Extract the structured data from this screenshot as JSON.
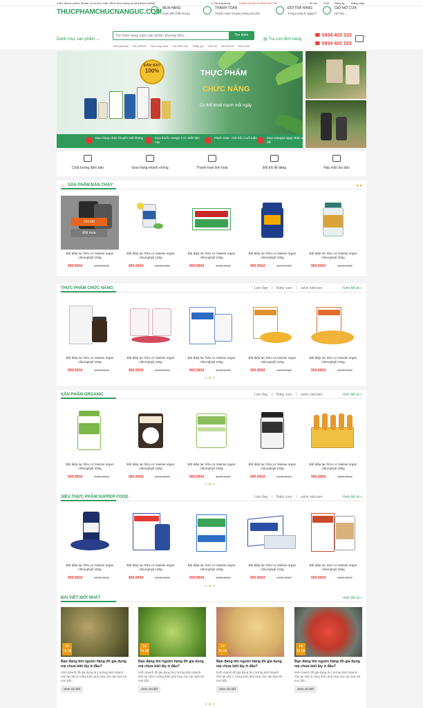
{
  "topbar": {
    "promo_prefix": "Bio Island Lysine Starter",
    "promo_text": "Lý ra bình luận \"Mình pha chung và sữa được không \"",
    "dist": "Tải ứng dụng",
    "hotline_label": "Khiếu nại bảo lỗi",
    "hotline": "0934 403 333",
    "links": [
      "Tin tức",
      "FQA",
      "Đăng ký",
      "Đăng nhập"
    ]
  },
  "header": {
    "logo": "THUCPHAMCHUCNANGUC.COM",
    "features": [
      {
        "title": "MUA HÀNG",
        "sub": "Cam kết chất lượng"
      },
      {
        "title": "THANH TOÁN",
        "sub": "Thanh toán và giao hàng tại nhà"
      },
      {
        "title": "ĐỔI TRẢ HÀNG",
        "sub": "Trong vòng 5 ngày(*)"
      },
      {
        "title": "GIỜ MỞ CỬA",
        "sub": "Hà Nội ⌄"
      }
    ]
  },
  "nav": {
    "category_label": "Danh mục sản phẩm ⌄",
    "search_placeholder": "Tìm kiếm hàng ngàn sản phẩm, thương hiệu...",
    "search_button": "Tìm kiếm",
    "tags": [
      "Tảo spirulina",
      "Bio oilZhim",
      "Sữa ong chúa",
      "Làn khỏi mùi",
      "Trắng gel",
      "Sữa dê",
      "Bồi bổ hơi",
      "Sữa chất"
    ],
    "track_label": "Tra cứu đơn hàng",
    "phones": [
      "0934 403 333",
      "0934 403 333"
    ],
    "cart_count": "0"
  },
  "banner": {
    "badge_top": "ĐẢM BẢO",
    "badge_pct": "100%",
    "title_line1": "THỰC PHẨM",
    "title_line2": "CHỨC NĂNG",
    "subtitle": "Có thể khoẻ mạnh mỗi ngày",
    "promos": [
      "Mua hàng nhận khuyến mãi khủng",
      "Mua thuốc omega 3 rẻ nhất hiện nay",
      "Flash Sale - Giá Sốc Cuối tuần",
      "Mua omega3 ngay nhận ngay ưu đãi"
    ]
  },
  "services": [
    "Chất lượng đảm bảo",
    "Giao hàng nhanh chóng",
    "Thanh toán linh hoạt",
    "Đổi trả dễ dàng",
    "Hậu mãi chu đáo"
  ],
  "product": {
    "name": "Bột diệp lục hữu cơ Swisse organ chlorophyll 100g",
    "price": "900.000đ",
    "old_price": "1000.000đ",
    "hover_detail": "Chi tiết",
    "hover_buy": "Đặt mua"
  },
  "sections": {
    "bestseller": {
      "title": "SẢN PHẨM BÁN CHẠY"
    },
    "functional": {
      "title": "THỰC PHẨM CHỨC NĂNG",
      "cats": [
        "Làm đẹp",
        "\\",
        "Baby care",
        "\\",
        "sukin skincare"
      ],
      "more": "Xem tất cả »"
    },
    "organic": {
      "title": "SẢN PHẨM ORGANIC",
      "cats": [
        "Làm đẹp",
        "\\",
        "Baby care",
        "\\",
        "sukin skincare"
      ],
      "more": "Xem tất cả »"
    },
    "superfood": {
      "title": "SIEU THỰC PHẨM SUPPER FOOD",
      "cats": [
        "Làm đẹp",
        "\\",
        "Baby care",
        "\\",
        "sukin skincare"
      ],
      "more": "Xem tất cả »"
    },
    "blog": {
      "title": "BÀI VIẾT MỚI NHẤT",
      "more": "Xem tất cả »"
    }
  },
  "posts": {
    "day": "19",
    "month": "Th 05",
    "title": "Bạn đang tìm nguồn hàng đồ gia dụng mà chưa biết lấy ở đâu?",
    "desc": "Kinh doanh đồ gia dụng là ý tưởng kinh doanh nhỏ tại nhà ở nông thôn phù hợp cho các bạn trẻ mới bắt ...",
    "read_more": "Xem chi tiết"
  },
  "icons": [
    "fire-icon",
    "cart-icon",
    "phone-icon",
    "search-icon",
    "truck-icon",
    "card-icon",
    "exchange-icon",
    "support-icon"
  ],
  "colors": {
    "brand": "#2f9a5b",
    "price": "#e53935",
    "accent": "#f2a900"
  }
}
